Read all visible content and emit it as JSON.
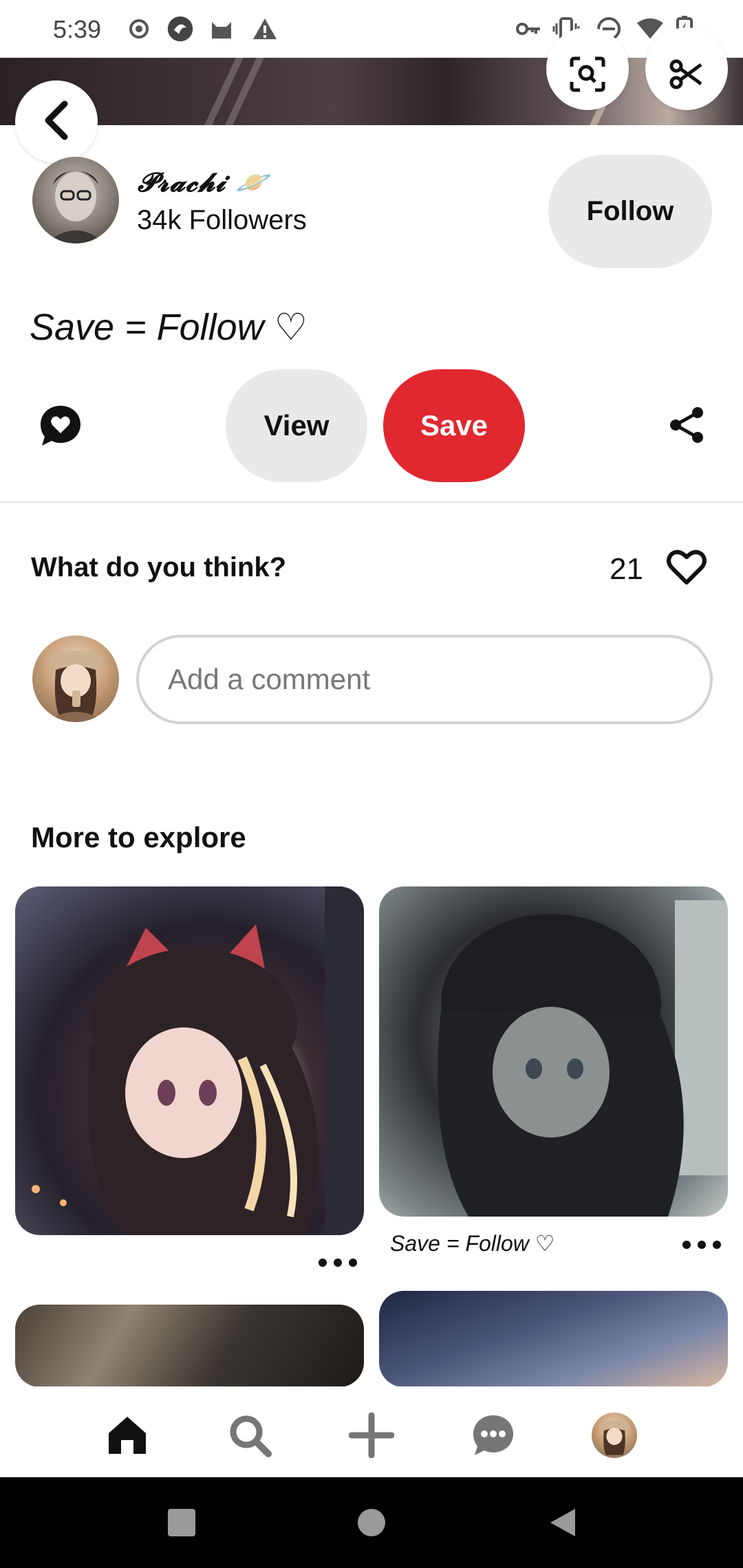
{
  "status_bar": {
    "time": "5:39",
    "left_icons": [
      "record-icon",
      "app-icon",
      "cat-icon",
      "warning-icon"
    ],
    "right_icons": [
      "key-icon",
      "vibrate-icon",
      "dnd-icon",
      "wifi-icon",
      "battery-charging-icon"
    ]
  },
  "top_actions": {
    "back_icon": "chevron-left-icon",
    "lens_icon": "visual-search-icon",
    "cut_icon": "scissors-icon"
  },
  "creator": {
    "name": "𝓟𝓻𝓪𝓬𝓱𝓲 🪐",
    "followers": "34k Followers",
    "follow_label": "Follow"
  },
  "pin": {
    "title": "Save = Follow ♡"
  },
  "actions": {
    "view_label": "View",
    "save_label": "Save",
    "colors": {
      "save": "#e0282e",
      "secondary": "#e9e9e9"
    }
  },
  "comments": {
    "heading": "What do you think?",
    "like_count": "21",
    "input_placeholder": "Add a comment"
  },
  "explore": {
    "heading": "More to explore",
    "pins": [
      {
        "caption": "",
        "more_icon": "more-horizontal-icon"
      },
      {
        "caption": "Save = Follow ♡",
        "more_icon": "more-horizontal-icon"
      },
      {
        "caption": ""
      },
      {
        "caption": ""
      }
    ]
  },
  "bottom_nav": {
    "items": [
      "home-icon",
      "search-icon",
      "create-icon",
      "messages-icon",
      "profile-avatar"
    ],
    "active": "home-icon"
  },
  "system_nav": {
    "items": [
      "recents-icon",
      "home-circle-icon",
      "back-triangle-icon"
    ]
  }
}
